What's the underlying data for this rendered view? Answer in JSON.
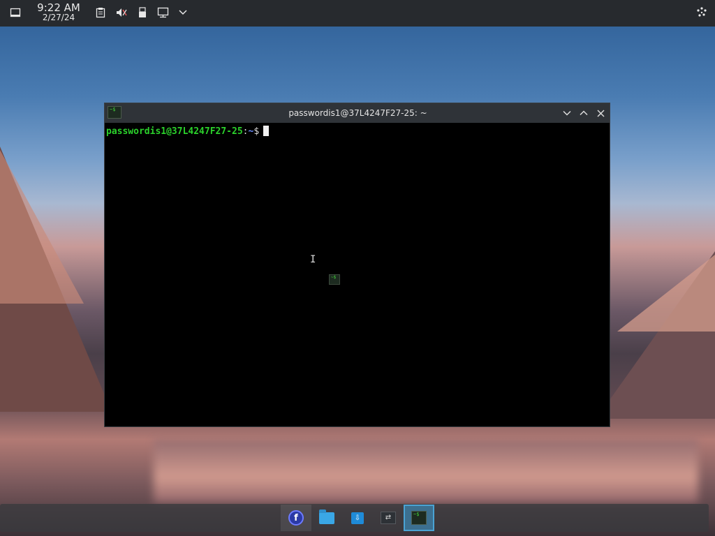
{
  "top_panel": {
    "clock_time": "9:22 AM",
    "clock_date": "2/27/24",
    "icons": [
      "show-desktop-icon",
      "clipboard-icon",
      "volume-muted-icon",
      "usb-device-icon",
      "network-icon",
      "expand-tray-icon",
      "activities-icon"
    ]
  },
  "window": {
    "title": "passwordis1@37L4247F27-25: ~",
    "app_icon_text": "~$",
    "buttons": [
      "minimize",
      "maximize",
      "close"
    ]
  },
  "terminal": {
    "prompt_user_host": "passwordis1@37L4247F27-25",
    "prompt_sep": ":",
    "prompt_path": "~",
    "prompt_symbol": "$"
  },
  "taskbar": {
    "apps": [
      {
        "name": "fedora-launcher",
        "icon": "fedora-icon",
        "label": "f"
      },
      {
        "name": "file-manager",
        "icon": "folder-icon"
      },
      {
        "name": "software-center",
        "icon": "store-icon"
      },
      {
        "name": "system-settings",
        "icon": "settings-icon"
      },
      {
        "name": "konsole",
        "icon": "konsole-icon",
        "active": true
      }
    ]
  },
  "colors": {
    "panel_bg": "#272a2e",
    "terminal_bg": "#000000",
    "prompt_green": "#2bd12b",
    "prompt_blue": "#6b8cff",
    "active_task": "#3c6f8f"
  }
}
